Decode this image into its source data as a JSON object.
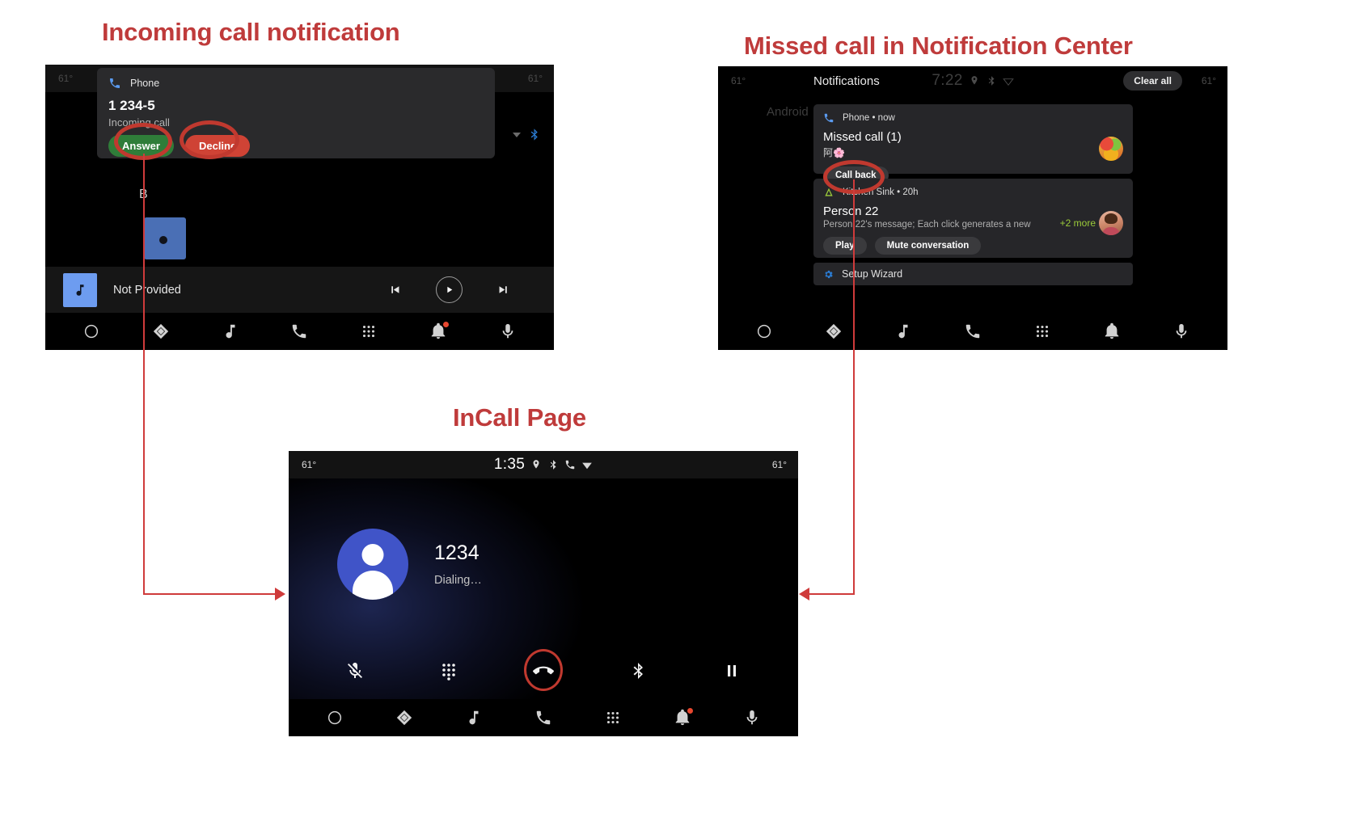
{
  "headings": {
    "incoming": "Incoming call notification",
    "missed": "Missed call in Notification Center",
    "incall": "InCall Page"
  },
  "screen_incoming": {
    "status": {
      "temp_left": "61°",
      "temp_right": "61°"
    },
    "home": {
      "label": "B",
      "bluetooth_icon": "bluetooth-icon"
    },
    "notification": {
      "app_icon": "phone-icon",
      "app_name": "Phone",
      "title": "1 234-5",
      "subtitle": "Incoming call",
      "answer_label": "Answer",
      "decline_label": "Decline",
      "answer_color": "#2f7d39",
      "decline_color": "#cf4335"
    },
    "media": {
      "art_icon": "music-note-icon",
      "title": "Not Provided",
      "prev_icon": "skip-previous-icon",
      "play_icon": "play-icon",
      "next_icon": "skip-next-icon"
    },
    "nav": [
      {
        "name": "home",
        "icon": "circle-icon"
      },
      {
        "name": "navigation",
        "icon": "navigation-diamond-icon"
      },
      {
        "name": "media",
        "icon": "music-note-icon"
      },
      {
        "name": "phone",
        "icon": "phone-icon"
      },
      {
        "name": "apps",
        "icon": "grid-icon"
      },
      {
        "name": "notifications",
        "icon": "bell-icon",
        "badge": true
      },
      {
        "name": "assistant",
        "icon": "microphone-icon"
      }
    ]
  },
  "screen_notifications": {
    "status": {
      "temp_left": "61°",
      "temp_right": "61°",
      "time": "7:22",
      "icons": [
        "location-icon",
        "bluetooth-icon",
        "wifi-icon"
      ]
    },
    "title": "Notifications",
    "clear_all": "Clear all",
    "ghost_text": "Android",
    "cards": [
      {
        "app_icon": "phone-icon",
        "app_name": "Phone • now",
        "title": "Missed call (1)",
        "emoji": "阿🌸",
        "buttons": [
          "Call back"
        ],
        "avatar": "fruit"
      },
      {
        "app_icon": "kitchen-sink-icon",
        "app_name": "Kitchen Sink • 20h",
        "title": "Person 22",
        "text": "Person 22's message; Each click generates a new",
        "more": "+2 more",
        "buttons": [
          "Play",
          "Mute conversation"
        ],
        "avatar": "person"
      }
    ],
    "setup_row": {
      "icon": "gear-icon",
      "label": "Setup Wizard"
    },
    "nav": [
      {
        "name": "home",
        "icon": "circle-icon"
      },
      {
        "name": "navigation",
        "icon": "navigation-diamond-icon"
      },
      {
        "name": "media",
        "icon": "music-note-icon"
      },
      {
        "name": "phone",
        "icon": "phone-icon"
      },
      {
        "name": "apps",
        "icon": "grid-icon"
      },
      {
        "name": "notifications",
        "icon": "bell-icon",
        "badge": false
      },
      {
        "name": "assistant",
        "icon": "microphone-icon"
      }
    ]
  },
  "screen_incall": {
    "status": {
      "temp_left": "61°",
      "temp_right": "61°",
      "time": "1:35",
      "icons": [
        "location-icon",
        "bluetooth-icon",
        "call-icon",
        "wifi-icon"
      ]
    },
    "caller": {
      "avatar_icon": "person-avatar-icon",
      "number": "1234",
      "state": "Dialing…"
    },
    "controls": [
      {
        "name": "mute",
        "icon": "mic-off-icon"
      },
      {
        "name": "dialpad",
        "icon": "dialpad-icon"
      },
      {
        "name": "end-call",
        "icon": "call-end-icon",
        "highlighted": true
      },
      {
        "name": "bluetooth",
        "icon": "bluetooth-icon"
      },
      {
        "name": "hold",
        "icon": "pause-icon"
      }
    ],
    "nav": [
      {
        "name": "home",
        "icon": "circle-icon"
      },
      {
        "name": "navigation",
        "icon": "navigation-diamond-icon"
      },
      {
        "name": "media",
        "icon": "music-note-icon"
      },
      {
        "name": "phone",
        "icon": "phone-icon"
      },
      {
        "name": "apps",
        "icon": "grid-icon"
      },
      {
        "name": "notifications",
        "icon": "bell-icon",
        "badge": true
      },
      {
        "name": "assistant",
        "icon": "microphone-icon"
      }
    ]
  },
  "annotations": {
    "highlight_color": "#c0392f",
    "arrow_color": "#cf3b3b"
  }
}
